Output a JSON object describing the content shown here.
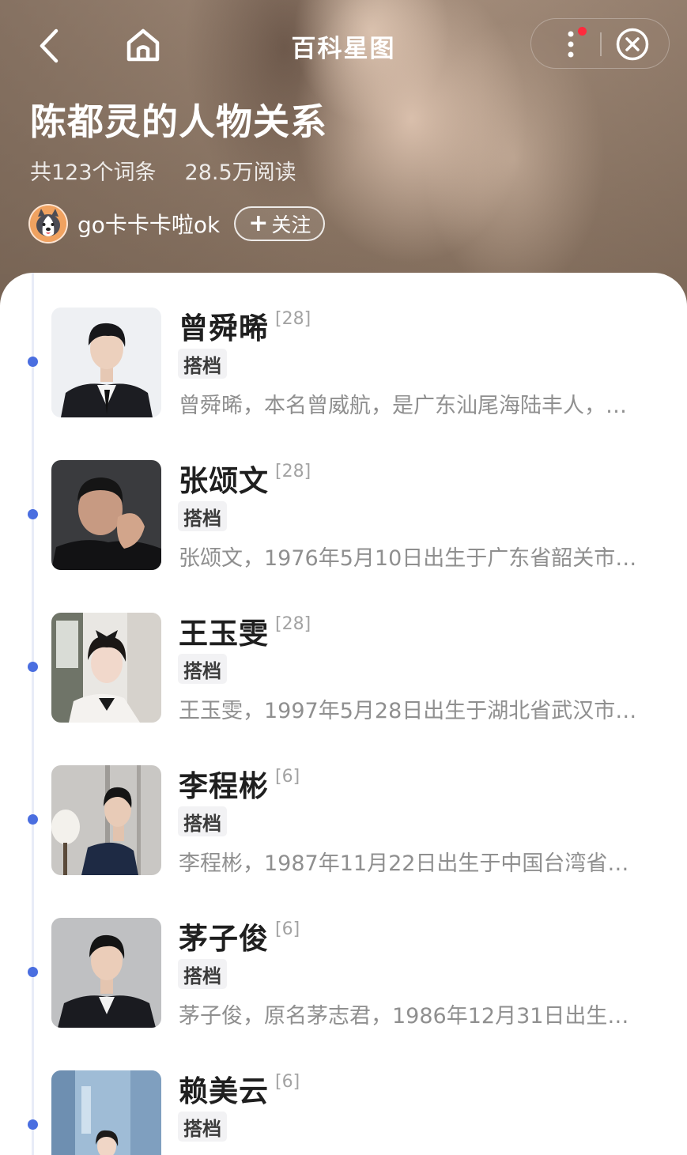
{
  "nav": {
    "title": "百科星图"
  },
  "header": {
    "title": "陈都灵的人物关系",
    "entries": "共123个词条",
    "reads": "28.5万阅读",
    "author": "go卡卡卡啦ok",
    "follow_label": "关注"
  },
  "people": [
    {
      "name": "曾舜晞",
      "count": "[28]",
      "tag": "搭档",
      "desc": "曾舜晞，本名曾威航，是广东汕尾海陆丰人，…"
    },
    {
      "name": "张颂文",
      "count": "[28]",
      "tag": "搭档",
      "desc": "张颂文，1976年5月10日出生于广东省韶关市…"
    },
    {
      "name": "王玉雯",
      "count": "[28]",
      "tag": "搭档",
      "desc": "王玉雯，1997年5月28日出生于湖北省武汉市…"
    },
    {
      "name": "李程彬",
      "count": "[6]",
      "tag": "搭档",
      "desc": "李程彬，1987年11月22日出生于中国台湾省…"
    },
    {
      "name": "茅子俊",
      "count": "[6]",
      "tag": "搭档",
      "desc": "茅子俊，原名茅志君，1986年12月31日出生…"
    },
    {
      "name": "赖美云",
      "count": "[6]",
      "tag": "搭档",
      "desc": ""
    }
  ],
  "colors": {
    "accent": "#4a6ee0",
    "notification": "#ff2a3d"
  }
}
